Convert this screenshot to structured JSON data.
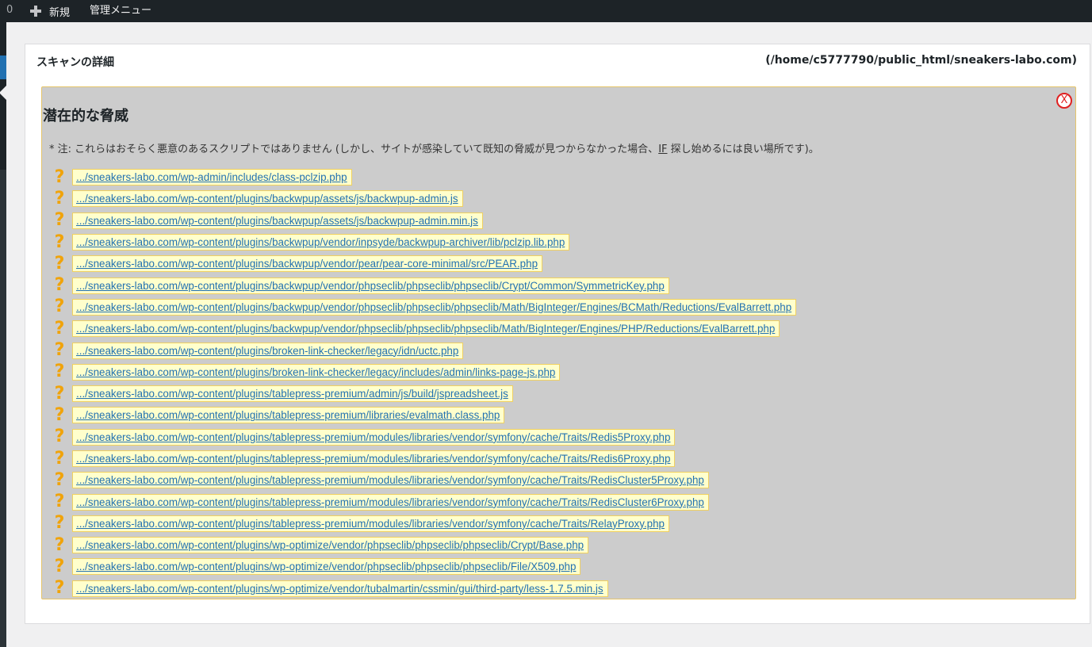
{
  "adminbar": {
    "count": "0",
    "new_label": "新規",
    "manage_label": "管理メニュー"
  },
  "panel": {
    "title": "スキャンの詳細",
    "path": "(/home/c5777790/public_html/sneakers-labo.com)"
  },
  "threats": {
    "heading": "潜在的な脅威",
    "close_label": "X",
    "note_before": "* 注: これらはおそらく悪意のあるスクリプトではありません (しかし、サイトが感染していて既知の脅威が見つからなかった場合、",
    "note_if": "IF",
    "note_after": " 探し始めるには良い場所です)。",
    "icon": "question-mark-icon",
    "files": [
      ".../sneakers-labo.com/wp-admin/includes/class-pclzip.php",
      ".../sneakers-labo.com/wp-content/plugins/backwpup/assets/js/backwpup-admin.js",
      ".../sneakers-labo.com/wp-content/plugins/backwpup/assets/js/backwpup-admin.min.js",
      ".../sneakers-labo.com/wp-content/plugins/backwpup/vendor/inpsyde/backwpup-archiver/lib/pclzip.lib.php",
      ".../sneakers-labo.com/wp-content/plugins/backwpup/vendor/pear/pear-core-minimal/src/PEAR.php",
      ".../sneakers-labo.com/wp-content/plugins/backwpup/vendor/phpseclib/phpseclib/phpseclib/Crypt/Common/SymmetricKey.php",
      ".../sneakers-labo.com/wp-content/plugins/backwpup/vendor/phpseclib/phpseclib/phpseclib/Math/BigInteger/Engines/BCMath/Reductions/EvalBarrett.php",
      ".../sneakers-labo.com/wp-content/plugins/backwpup/vendor/phpseclib/phpseclib/phpseclib/Math/BigInteger/Engines/PHP/Reductions/EvalBarrett.php",
      ".../sneakers-labo.com/wp-content/plugins/broken-link-checker/legacy/idn/uctc.php",
      ".../sneakers-labo.com/wp-content/plugins/broken-link-checker/legacy/includes/admin/links-page-js.php",
      ".../sneakers-labo.com/wp-content/plugins/tablepress-premium/admin/js/build/jspreadsheet.js",
      ".../sneakers-labo.com/wp-content/plugins/tablepress-premium/libraries/evalmath.class.php",
      ".../sneakers-labo.com/wp-content/plugins/tablepress-premium/modules/libraries/vendor/symfony/cache/Traits/Redis5Proxy.php",
      ".../sneakers-labo.com/wp-content/plugins/tablepress-premium/modules/libraries/vendor/symfony/cache/Traits/Redis6Proxy.php",
      ".../sneakers-labo.com/wp-content/plugins/tablepress-premium/modules/libraries/vendor/symfony/cache/Traits/RedisCluster5Proxy.php",
      ".../sneakers-labo.com/wp-content/plugins/tablepress-premium/modules/libraries/vendor/symfony/cache/Traits/RedisCluster6Proxy.php",
      ".../sneakers-labo.com/wp-content/plugins/tablepress-premium/modules/libraries/vendor/symfony/cache/Traits/RelayProxy.php",
      ".../sneakers-labo.com/wp-content/plugins/wp-optimize/vendor/phpseclib/phpseclib/phpseclib/Crypt/Base.php",
      ".../sneakers-labo.com/wp-content/plugins/wp-optimize/vendor/phpseclib/phpseclib/phpseclib/File/X509.php",
      ".../sneakers-labo.com/wp-content/plugins/wp-optimize/vendor/tubalmartin/cssmin/gui/third-party/less-1.7.5.min.js"
    ]
  }
}
